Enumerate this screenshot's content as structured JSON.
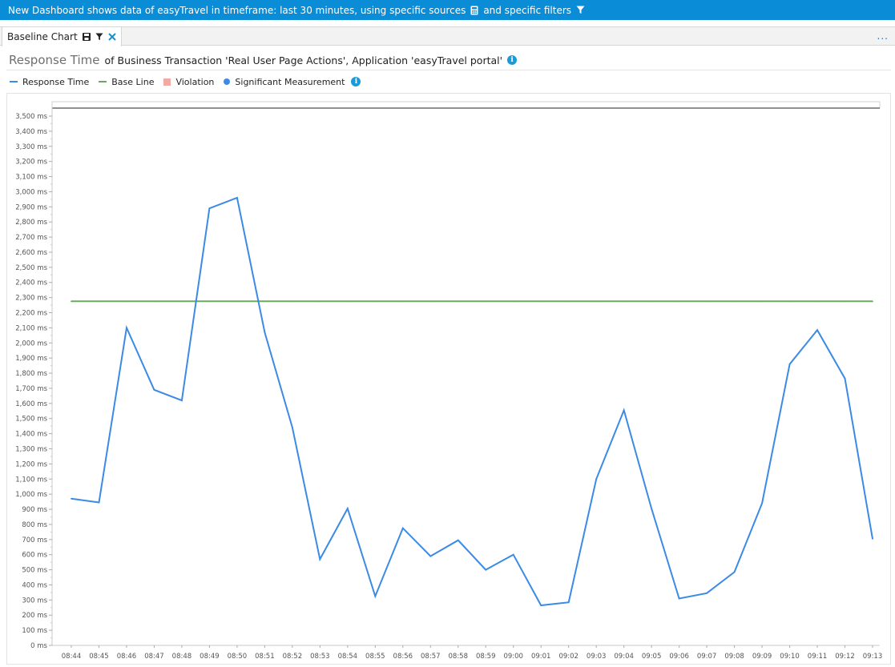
{
  "topbar": {
    "text1": "New Dashboard shows data of easyTravel in timeframe: last 30 minutes, using specific sources",
    "text2": "and specific filters",
    "sources_icon": "calculator-icon",
    "filters_icon": "filter-icon"
  },
  "tab": {
    "label": "Baseline Chart",
    "icons": [
      "save-icon",
      "filter-icon",
      "close-icon"
    ],
    "more": "..."
  },
  "header": {
    "title": "Response Time",
    "subtitle": "of Business Transaction 'Real User Page Actions', Application 'easyTravel portal'"
  },
  "legend": [
    {
      "label": "Response Time",
      "color": "#3b8ae6",
      "shape": "line"
    },
    {
      "label": "Base Line",
      "color": "#6aaa5e",
      "shape": "line"
    },
    {
      "label": "Violation",
      "color": "#f2aaa4",
      "shape": "box"
    },
    {
      "label": "Significant Measurement",
      "color": "#3b8ae6",
      "shape": "dot"
    }
  ],
  "chart_data": {
    "type": "line",
    "categories": [
      "08:44",
      "08:45",
      "08:46",
      "08:47",
      "08:48",
      "08:49",
      "08:50",
      "08:51",
      "08:52",
      "08:53",
      "08:54",
      "08:55",
      "08:56",
      "08:57",
      "08:58",
      "08:59",
      "09:00",
      "09:01",
      "09:02",
      "09:03",
      "09:04",
      "09:05",
      "09:06",
      "09:07",
      "09:08",
      "09:09",
      "09:10",
      "09:11",
      "09:12",
      "09:13"
    ],
    "series": [
      {
        "name": "Response Time",
        "color": "#3b8ae6",
        "values": [
          970,
          945,
          2100,
          1690,
          1620,
          2890,
          2960,
          2070,
          1440,
          570,
          905,
          325,
          775,
          590,
          695,
          500,
          600,
          265,
          285,
          1100,
          1555,
          905,
          310,
          345,
          485,
          940,
          1860,
          2085,
          1765,
          705
        ]
      },
      {
        "name": "Base Line",
        "color": "#6aaa5e",
        "values": [
          2275,
          2275,
          2275,
          2275,
          2275,
          2275,
          2275,
          2275,
          2275,
          2275,
          2275,
          2275,
          2275,
          2275,
          2275,
          2275,
          2275,
          2275,
          2275,
          2275,
          2275,
          2275,
          2275,
          2275,
          2275,
          2275,
          2275,
          2275,
          2275,
          2275
        ]
      }
    ],
    "ylim": [
      0,
      3500
    ],
    "ytick_step": 100,
    "y_unit": "ms",
    "grid": false,
    "legend_position": "top-left"
  }
}
